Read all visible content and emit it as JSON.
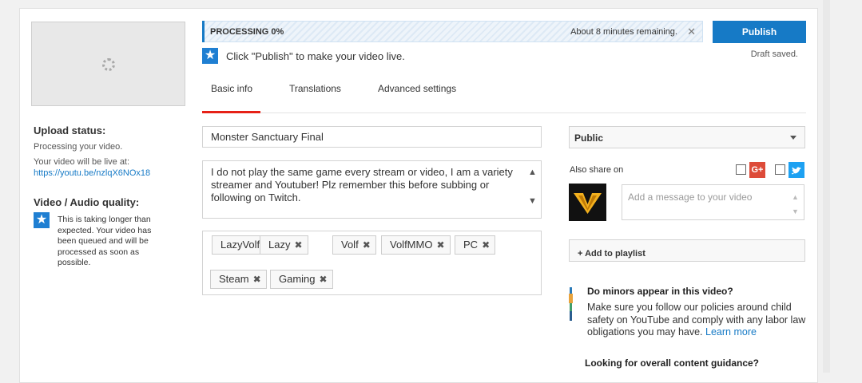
{
  "upload": {
    "progress_label": "PROCESSING 0%",
    "progress_fraction": 0,
    "time_remaining": "About 8 minutes remaining.",
    "close_glyph": "✕",
    "publish_label": "Publish",
    "draft_status": "Draft saved.",
    "hint_text": "Click \"Publish\" to make your video live."
  },
  "sidebar": {
    "status_heading": "Upload status:",
    "status_text": "Processing your video.",
    "live_at_label": "Your video will be live at:",
    "live_url": "https://youtu.be/nzlqX6NOx18",
    "quality_heading": "Video / Audio quality:",
    "quality_note": "This is taking longer than expected. Your video has been queued and will be processed as soon as possible."
  },
  "tabs": [
    {
      "label": "Basic info",
      "active": true
    },
    {
      "label": "Translations",
      "active": false
    },
    {
      "label": "Advanced settings",
      "active": false
    }
  ],
  "form": {
    "title_value": "Monster Sanctuary Final",
    "description_value": "I do not play the same game every stream or video, I am a variety streamer and Youtuber! Plz remember this before subbing or following on Twitch.",
    "tags": [
      "LazyVolf",
      "Lazy",
      "Volf",
      "VolfMMO",
      "PC",
      "Steam",
      "Gaming"
    ],
    "tag_remove_glyph": "✖"
  },
  "sharing": {
    "privacy_value": "Public",
    "also_share_label": "Also share on",
    "gplus_label": "G+",
    "message_placeholder": "Add a message to your video",
    "playlist_label": "+ Add to playlist"
  },
  "minors": {
    "heading": "Do minors appear in this video?",
    "text": "Make sure you follow our policies around child safety on YouTube and comply with any labor law obligations you may have.",
    "link": "Learn more"
  },
  "guidance_heading": "Looking for overall content guidance?",
  "colors": {
    "accent_blue": "#167ac6",
    "tab_red": "#e62117",
    "avatar_gold": "#f2b01e"
  },
  "icons": {
    "hint": "star-info-icon",
    "spinner": "loading-spinner-icon",
    "gplus": "google-plus-icon",
    "twitter": "twitter-icon",
    "avatar": "volf-logo"
  }
}
